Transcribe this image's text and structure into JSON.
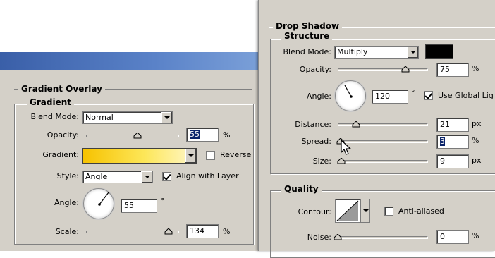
{
  "gradient_overlay": {
    "section_title": "Gradient Overlay",
    "group_title": "Gradient",
    "blend_mode": {
      "label": "Blend Mode:",
      "value": "Normal"
    },
    "opacity": {
      "label": "Opacity:",
      "value": "55",
      "unit": "%",
      "slider_fraction": 0.55
    },
    "gradient": {
      "label": "Gradient:",
      "colors": [
        "#f6c200",
        "#fde75a",
        "#fff7cc"
      ]
    },
    "reverse": {
      "label": "Reverse",
      "checked": false
    },
    "style": {
      "label": "Style:",
      "value": "Angle"
    },
    "align_with_layer": {
      "label": "Align with Layer",
      "checked": true
    },
    "angle": {
      "label": "Angle:",
      "value": "55",
      "unit": "°"
    },
    "scale": {
      "label": "Scale:",
      "value": "134",
      "unit": "%",
      "slider_fraction": 0.89
    }
  },
  "drop_shadow": {
    "section_title": "Drop Shadow",
    "group_title": "Structure",
    "blend_mode": {
      "label": "Blend Mode:",
      "value": "Multiply",
      "swatch_color": "#000000"
    },
    "opacity": {
      "label": "Opacity:",
      "value": "75",
      "unit": "%",
      "slider_fraction": 0.75
    },
    "angle": {
      "label": "Angle:",
      "value": "120",
      "unit": "°"
    },
    "use_global_light": {
      "label": "Use Global Lig",
      "checked": true
    },
    "distance": {
      "label": "Distance:",
      "value": "21",
      "unit": "px",
      "slider_fraction": 0.2
    },
    "spread": {
      "label": "Spread:",
      "value": "3",
      "unit": "%",
      "slider_fraction": 0.03
    },
    "size": {
      "label": "Size:",
      "value": "9",
      "unit": "px",
      "slider_fraction": 0.04
    }
  },
  "quality": {
    "group_title": "Quality",
    "contour": {
      "label": "Contour:"
    },
    "anti_aliased": {
      "label": "Anti-aliased",
      "checked": false
    },
    "noise": {
      "label": "Noise:",
      "value": "0",
      "unit": "%",
      "slider_fraction": 0.0
    }
  },
  "colors": {
    "dialog_bg": "#d4d0c8",
    "titlebar": "#3a5fa8",
    "selection": "#0a246a"
  }
}
